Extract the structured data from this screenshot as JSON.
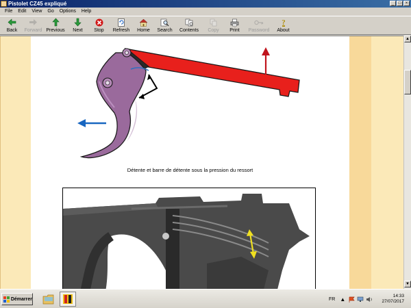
{
  "window": {
    "title": "Pistolet CZ45 expliqué"
  },
  "menu": [
    "File",
    "Edit",
    "View",
    "Go",
    "Options",
    "Help"
  ],
  "toolbar": {
    "back": "Back",
    "forward": "Forward",
    "previous": "Previous",
    "next": "Next",
    "stop": "Stop",
    "refresh": "Refresh",
    "home": "Home",
    "search": "Search",
    "contents": "Contents",
    "copy": "Copy",
    "print": "Print",
    "password": "Password",
    "about": "About"
  },
  "page": {
    "caption": "Détente et barre de détente sous la pression du ressort"
  },
  "colors": {
    "trigger_bar": "#e8201c",
    "trigger": "#9a6a9c",
    "arrow_red": "#c0141c",
    "arrow_blue": "#1866c0",
    "band_light": "#fbe9b8",
    "band_dark": "#f8d99a"
  },
  "taskbar": {
    "start": "Démarrer",
    "lang": "FR",
    "time": "14:33",
    "date": "27/07/2017"
  }
}
